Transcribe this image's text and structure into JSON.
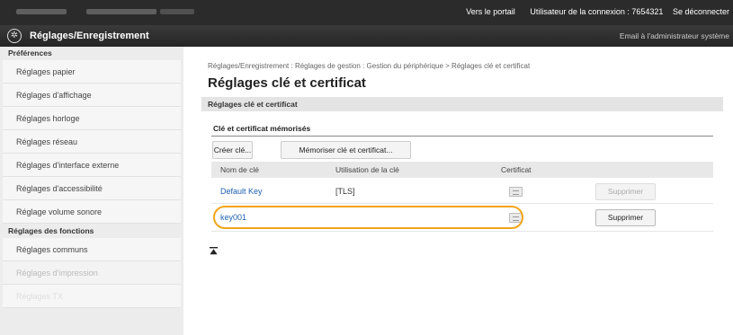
{
  "topbar": {
    "portal_link": "Vers le portail",
    "user_label": "Utilisateur de la connexion : 7654321",
    "logout_link": "Se déconnecter"
  },
  "titlebar": {
    "app_title": "Réglages/Enregistrement",
    "mail_admin_link": "Email à l'administrateur système"
  },
  "sidebar": {
    "sections": [
      {
        "header": "Préférences",
        "items": [
          {
            "label": "Réglages papier"
          },
          {
            "label": "Réglages d'affichage"
          },
          {
            "label": "Réglages horloge"
          },
          {
            "label": "Réglages réseau"
          },
          {
            "label": "Réglages d'interface externe"
          },
          {
            "label": "Réglages d'accessibilité"
          },
          {
            "label": "Réglage volume sonore"
          }
        ]
      },
      {
        "header": "Réglages des fonctions",
        "items": [
          {
            "label": "Réglages communs"
          },
          {
            "label": "Réglages d'impression"
          },
          {
            "label": "Réglages TX"
          }
        ]
      }
    ]
  },
  "main": {
    "breadcrumb": "Réglages/Enregistrement : Réglages de gestion : Gestion du périphérique > Réglages clé et certificat",
    "page_title": "Réglages clé et certificat",
    "section_title": "Réglages clé et certificat",
    "subsection_title": "Clé et certificat mémorisés",
    "create_key_button": "Créer clé...",
    "register_button": "Mémoriser clé et certificat...",
    "table": {
      "columns": [
        "Nom de clé",
        "Utilisation de la clé",
        "Certificat"
      ],
      "rows": [
        {
          "key_name": "Default Key",
          "usage": "[TLS]",
          "delete_label": "Supprimer",
          "delete_enabled": false
        },
        {
          "key_name": "key001",
          "usage": "",
          "delete_label": "Supprimer",
          "delete_enabled": true
        }
      ]
    },
    "back_to_top_icon": "back-to-top-icon",
    "highlight_color": "#f1a51b"
  }
}
